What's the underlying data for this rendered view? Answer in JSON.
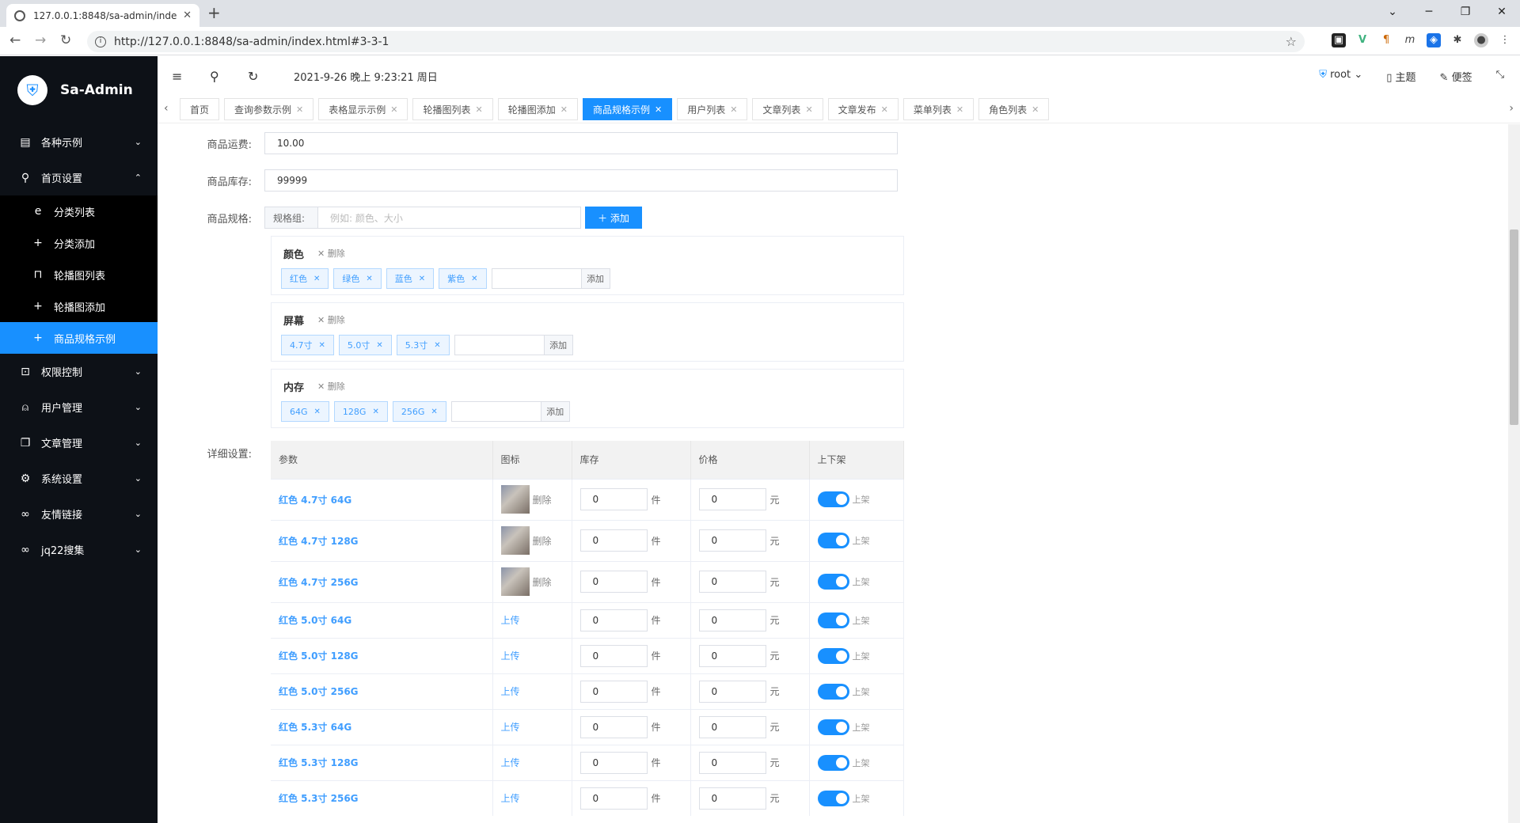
{
  "browser": {
    "tab_title": "127.0.0.1:8848/sa-admin/inde",
    "url": "http://127.0.0.1:8848/sa-admin/index.html#3-3-1"
  },
  "app": {
    "name": "Sa-Admin"
  },
  "sidebar": {
    "items": [
      {
        "label": "各种示例"
      },
      {
        "label": "首页设置"
      },
      {
        "label": "权限控制"
      },
      {
        "label": "用户管理"
      },
      {
        "label": "文章管理"
      },
      {
        "label": "系统设置"
      },
      {
        "label": "友情链接"
      },
      {
        "label": "jq22搜集"
      }
    ],
    "subitems": [
      {
        "label": "分类列表"
      },
      {
        "label": "分类添加"
      },
      {
        "label": "轮播图列表"
      },
      {
        "label": "轮播图添加"
      },
      {
        "label": "商品规格示例"
      }
    ]
  },
  "topbar": {
    "datetime": "2021-9-26 晚上 9:23:21 周日",
    "user": "root",
    "theme": "主题",
    "notes": "便签"
  },
  "tabs": [
    {
      "label": "首页"
    },
    {
      "label": "查询参数示例"
    },
    {
      "label": "表格显示示例"
    },
    {
      "label": "轮播图列表"
    },
    {
      "label": "轮播图添加"
    },
    {
      "label": "商品规格示例"
    },
    {
      "label": "用户列表"
    },
    {
      "label": "文章列表"
    },
    {
      "label": "文章发布"
    },
    {
      "label": "菜单列表"
    },
    {
      "label": "角色列表"
    }
  ],
  "form": {
    "shipping_label": "商品运费:",
    "shipping_value": "10.00",
    "stock_label": "商品库存:",
    "stock_value": "99999",
    "spec_label": "商品规格:",
    "spec_group_prefix": "规格组:",
    "spec_group_placeholder": "例如: 颜色、大小",
    "add_button": "添加",
    "delete_label": "删除",
    "tag_add": "添加",
    "detail_label": "详细设置:"
  },
  "spec_groups": [
    {
      "name": "颜色",
      "values": [
        "红色",
        "绿色",
        "蓝色",
        "紫色"
      ]
    },
    {
      "name": "屏幕",
      "values": [
        "4.7寸",
        "5.0寸",
        "5.3寸"
      ]
    },
    {
      "name": "内存",
      "values": [
        "64G",
        "128G",
        "256G"
      ]
    }
  ],
  "table": {
    "headers": [
      "参数",
      "图标",
      "库存",
      "价格",
      "上下架"
    ],
    "unit_stock": "件",
    "unit_price": "元",
    "status_on": "上架",
    "upload_label": "上传",
    "delete_label": "删除",
    "rows": [
      {
        "param": "红色 4.7寸 64G",
        "stock": "0",
        "price": "0"
      },
      {
        "param": "红色 4.7寸 128G",
        "stock": "0",
        "price": "0"
      },
      {
        "param": "红色 4.7寸 256G",
        "stock": "0",
        "price": "0"
      },
      {
        "param": "红色 5.0寸 64G",
        "stock": "0",
        "price": "0"
      },
      {
        "param": "红色 5.0寸 128G",
        "stock": "0",
        "price": "0"
      },
      {
        "param": "红色 5.0寸 256G",
        "stock": "0",
        "price": "0"
      },
      {
        "param": "红色 5.3寸 64G",
        "stock": "0",
        "price": "0"
      },
      {
        "param": "红色 5.3寸 128G",
        "stock": "0",
        "price": "0"
      },
      {
        "param": "红色 5.3寸 256G",
        "stock": "0",
        "price": "0"
      }
    ]
  }
}
